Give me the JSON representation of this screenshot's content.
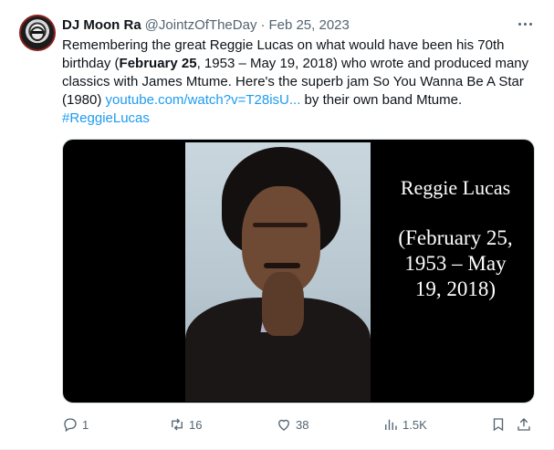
{
  "tweet": {
    "author_name": "DJ Moon Ra",
    "author_handle": "@JointzOfTheDay",
    "separator": "·",
    "date": "Feb 25, 2023",
    "text_part1": "Remembering the great Reggie Lucas on what would have been his 70th birthday (",
    "text_bold": "February 25",
    "text_part2": ", 1953 – May 19, 2018) who wrote and produced many classics with James Mtume. Here's the superb jam So You Wanna Be A Star (1980) ",
    "link_text": "youtube.com/watch?v=T28isU...",
    "text_part3": " by their own band Mtume. ",
    "hashtag": "#ReggieLucas"
  },
  "media": {
    "caption_name": "Reggie Lucas",
    "caption_dates": "(February 25, 1953 – May 19, 2018)"
  },
  "actions": {
    "replies": "1",
    "retweets": "16",
    "likes": "38",
    "views": "1.5K"
  },
  "icons": {
    "more": "more-horizontal-icon",
    "reply": "reply-icon",
    "retweet": "retweet-icon",
    "like": "heart-icon",
    "views": "views-chart-icon",
    "bookmark": "bookmark-icon",
    "share": "share-icon"
  },
  "colors": {
    "link": "#1d9bf0",
    "secondary_text": "#536471",
    "primary_text": "#0f1419"
  }
}
